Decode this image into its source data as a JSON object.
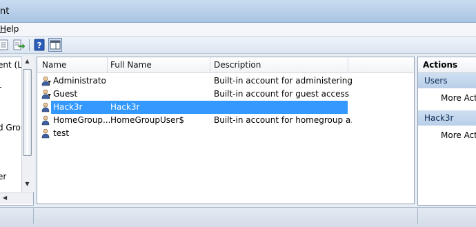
{
  "window": {
    "title_fragment": "nt"
  },
  "menu": {
    "help_first": "H",
    "help_rest": "elp"
  },
  "toolbar": {
    "icons": [
      "properties-icon",
      "export-list-icon",
      "help-icon",
      "show-action-pane-icon"
    ]
  },
  "tree": {
    "items": [
      "ent (Lo",
      "r",
      "d Grou",
      "er"
    ]
  },
  "list": {
    "columns": [
      "Name",
      "Full Name",
      "Description"
    ],
    "rows": [
      {
        "name": "Administrator",
        "full_name": "",
        "description": "Built-in account for administering...",
        "icon": "admin-user-icon",
        "selected": false
      },
      {
        "name": "Guest",
        "full_name": "",
        "description": "Built-in account for guest access t...",
        "icon": "guest-user-icon",
        "selected": false
      },
      {
        "name": "Hack3r",
        "full_name": "Hack3r",
        "description": "",
        "icon": "user-icon",
        "selected": true
      },
      {
        "name": "HomeGroup...",
        "full_name": "HomeGroupUser$",
        "description": "Built-in account for homegroup a...",
        "icon": "user-icon",
        "selected": false
      },
      {
        "name": "test",
        "full_name": "",
        "description": "",
        "icon": "user-icon",
        "selected": false
      }
    ]
  },
  "actions": {
    "title": "Actions",
    "sections": [
      {
        "label": "Users",
        "item": "More Acti"
      },
      {
        "label": "Hack3r",
        "item": "More Acti"
      }
    ]
  },
  "colors": {
    "selection": "#3399ff",
    "section_header": "#c4d7ee"
  }
}
